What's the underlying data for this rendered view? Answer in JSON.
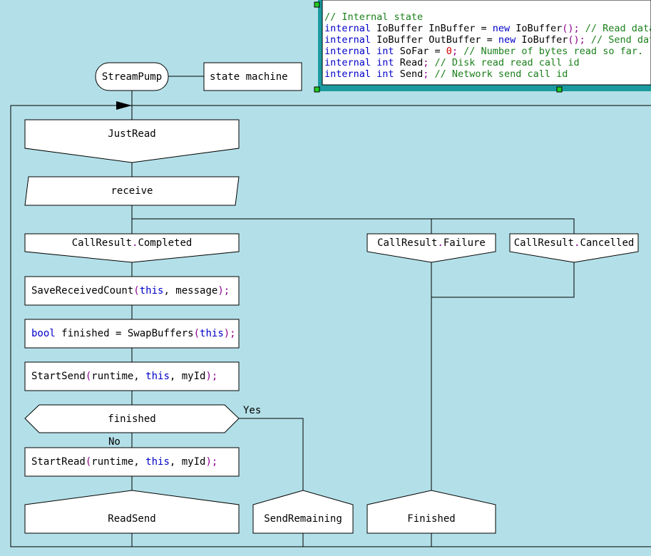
{
  "header": {
    "start_node": "StreamPump",
    "state_machine_label": "state machine"
  },
  "code_panel": {
    "lines": [
      [
        {
          "t": "// Internal state",
          "c": "cm"
        }
      ],
      [
        {
          "t": "internal",
          "c": "kw"
        },
        {
          "t": " IoBuffer InBuffer = ",
          "c": "tx"
        },
        {
          "t": "new",
          "c": "kw"
        },
        {
          "t": " IoBuffer",
          "c": "tx"
        },
        {
          "t": "();",
          "c": "pn"
        },
        {
          "t": " // Read data",
          "c": "cm"
        }
      ],
      [
        {
          "t": "internal",
          "c": "kw"
        },
        {
          "t": " IoBuffer OutBuffer = ",
          "c": "tx"
        },
        {
          "t": "new",
          "c": "kw"
        },
        {
          "t": " IoBuffer",
          "c": "tx"
        },
        {
          "t": "();",
          "c": "pn"
        },
        {
          "t": " // Send data",
          "c": "cm"
        }
      ],
      [
        {
          "t": "internal",
          "c": "kw"
        },
        {
          "t": " ",
          "c": "tx"
        },
        {
          "t": "int",
          "c": "kw"
        },
        {
          "t": " SoFar = ",
          "c": "tx"
        },
        {
          "t": "0",
          "c": "nm"
        },
        {
          "t": ";",
          "c": "pn"
        },
        {
          "t": " // Number of bytes read so far.",
          "c": "cm"
        }
      ],
      [
        {
          "t": "internal",
          "c": "kw"
        },
        {
          "t": " ",
          "c": "tx"
        },
        {
          "t": "int",
          "c": "kw"
        },
        {
          "t": " Read",
          "c": "tx"
        },
        {
          "t": ";",
          "c": "pn"
        },
        {
          "t": " // Disk read read call id",
          "c": "cm"
        }
      ],
      [
        {
          "t": "internal",
          "c": "kw"
        },
        {
          "t": " ",
          "c": "tx"
        },
        {
          "t": "int",
          "c": "kw"
        },
        {
          "t": " Send",
          "c": "tx"
        },
        {
          "t": ";",
          "c": "pn"
        },
        {
          "t": " // Network send call id",
          "c": "cm"
        }
      ]
    ]
  },
  "nodes": {
    "just_read": "JustRead",
    "receive": "receive",
    "case_completed": [
      {
        "t": "CallResult",
        "c": "tx"
      },
      {
        "t": ".",
        "c": "pn"
      },
      {
        "t": "Completed",
        "c": "tx"
      }
    ],
    "case_failure": [
      {
        "t": "CallResult",
        "c": "tx"
      },
      {
        "t": ".",
        "c": "pn"
      },
      {
        "t": "Failure",
        "c": "tx"
      }
    ],
    "case_cancelled": [
      {
        "t": "CallResult",
        "c": "tx"
      },
      {
        "t": ".",
        "c": "pn"
      },
      {
        "t": "Cancelled",
        "c": "tx"
      }
    ],
    "action_save": [
      {
        "t": "SaveReceivedCount",
        "c": "tx"
      },
      {
        "t": "(",
        "c": "pn"
      },
      {
        "t": "this",
        "c": "kw"
      },
      {
        "t": ", message",
        "c": "tx"
      },
      {
        "t": ");",
        "c": "pn"
      }
    ],
    "action_swap": [
      {
        "t": "bool",
        "c": "kw"
      },
      {
        "t": " finished = SwapBuffers",
        "c": "tx"
      },
      {
        "t": "(",
        "c": "pn"
      },
      {
        "t": "this",
        "c": "kw"
      },
      {
        "t": ");",
        "c": "pn"
      }
    ],
    "action_start_send": [
      {
        "t": "StartSend",
        "c": "tx"
      },
      {
        "t": "(",
        "c": "pn"
      },
      {
        "t": "runtime, ",
        "c": "tx"
      },
      {
        "t": "this",
        "c": "kw"
      },
      {
        "t": ", myId",
        "c": "tx"
      },
      {
        "t": ");",
        "c": "pn"
      }
    ],
    "decision_finished": "finished",
    "label_yes": "Yes",
    "label_no": "No",
    "action_start_read": [
      {
        "t": "StartRead",
        "c": "tx"
      },
      {
        "t": "(",
        "c": "pn"
      },
      {
        "t": "runtime, ",
        "c": "tx"
      },
      {
        "t": "this",
        "c": "kw"
      },
      {
        "t": ", myId",
        "c": "tx"
      },
      {
        "t": ");",
        "c": "pn"
      }
    ],
    "end_read_send": "ReadSend",
    "end_send_remaining": "SendRemaining",
    "end_finished": "Finished"
  },
  "colors": {
    "background": "#b3e0e8",
    "panel_border": "#1a9aa0",
    "handle": "#22cc22",
    "keyword": "#0000c8",
    "comment": "#1a7f1a",
    "punct": "#8b008b",
    "number": "#d40000"
  }
}
